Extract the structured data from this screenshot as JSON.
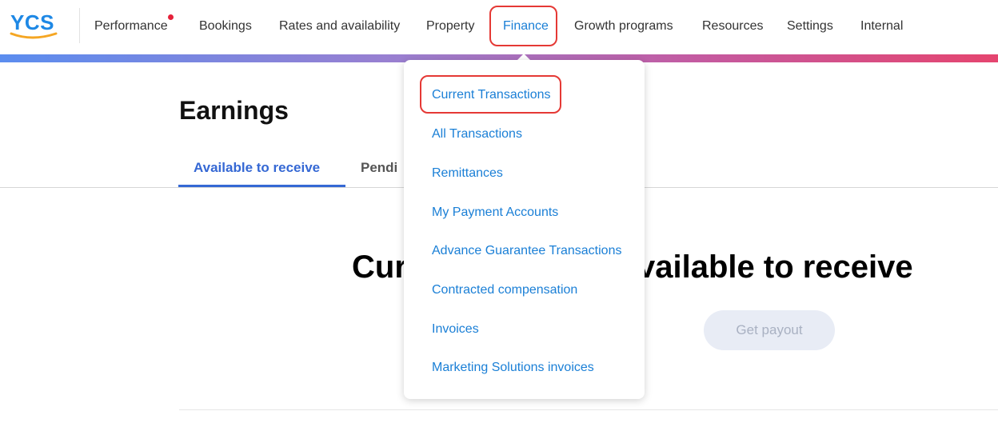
{
  "app": {
    "logo_text": "YCS",
    "colors": {
      "accent": "#3568d4",
      "link": "#1a7fd6",
      "highlight": "#e53935",
      "notification": "#e5213a"
    }
  },
  "nav": {
    "items": [
      {
        "label": "Performance",
        "has_notification_dot": true
      },
      {
        "label": "Bookings"
      },
      {
        "label": "Rates and availability"
      },
      {
        "label": "Property"
      },
      {
        "label": "Finance",
        "active": true
      },
      {
        "label": "Growth programs"
      },
      {
        "label": "Resources"
      },
      {
        "label": "Settings"
      },
      {
        "label": "Internal"
      }
    ]
  },
  "finance_menu": {
    "items": [
      {
        "label": "Current Transactions",
        "highlighted": true
      },
      {
        "label": "All Transactions"
      },
      {
        "label": "Remittances"
      },
      {
        "label": "My Payment Accounts"
      },
      {
        "label": "Advance Guarantee Transactions"
      },
      {
        "label": "Contracted compensation"
      },
      {
        "label": "Invoices"
      },
      {
        "label": "Marketing Solutions invoices"
      }
    ]
  },
  "main": {
    "title": "Earnings",
    "tabs": [
      {
        "label": "Available to receive",
        "active": true
      },
      {
        "label": "Pendi"
      }
    ],
    "headline_left": "Cur",
    "headline_right": "vailable to receive",
    "payout_button": "Get payout"
  }
}
